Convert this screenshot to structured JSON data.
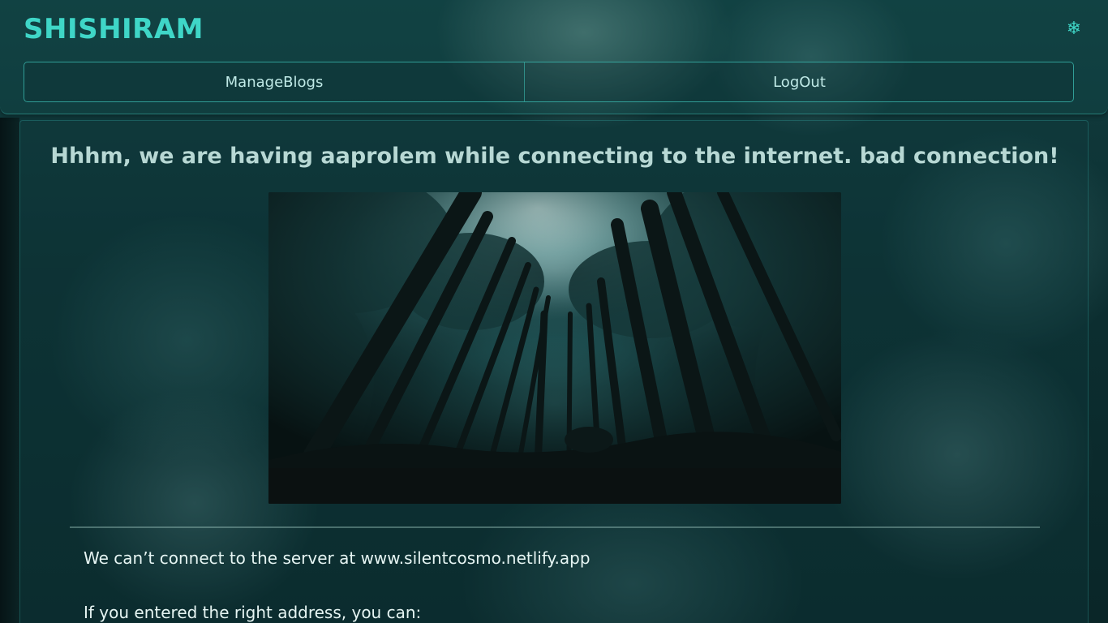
{
  "brand": {
    "title": "SHISHIRAM"
  },
  "header": {
    "theme_icon": "snowflake-icon",
    "theme_glyph": "❄"
  },
  "nav": {
    "items": [
      {
        "label": "ManageBlogs"
      },
      {
        "label": "LogOut"
      }
    ]
  },
  "main": {
    "headline": "Hhhm, we are having aaprolem while connecting to the internet. bad connection!",
    "image_alt": "forest",
    "message_line1": "We can’t connect to the server at www.silentcosmo.netlify.app",
    "message_line2": "If you entered the right address, you can:"
  },
  "colors": {
    "accent": "#3fd6c7",
    "headline": "#b7d8d4",
    "text": "#e6f5f3"
  }
}
